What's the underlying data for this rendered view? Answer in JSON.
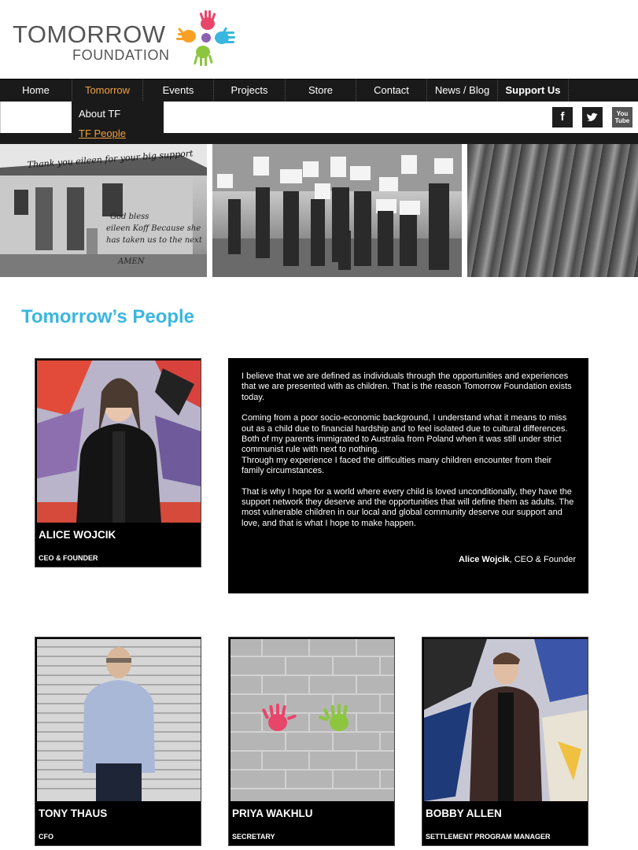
{
  "logo": {
    "line1": "TOMORROW",
    "line2": "FOUNDATION"
  },
  "nav": {
    "items": [
      {
        "label": "Home"
      },
      {
        "label": "Tomorrow"
      },
      {
        "label": "Events"
      },
      {
        "label": "Projects"
      },
      {
        "label": "Store"
      },
      {
        "label": "Contact"
      },
      {
        "label": "News / Blog"
      },
      {
        "label": "Support Us"
      }
    ],
    "dropdown": [
      {
        "label": "About TF"
      },
      {
        "label": "TF People"
      }
    ]
  },
  "social": {
    "facebook": "f",
    "youtube": "You Tube"
  },
  "banner": {
    "sign_line1": "Thank you eileen for your big support",
    "sign_line2": "God bless",
    "sign_line3": "eileen Koff Because she",
    "sign_line4": "has taken us to the next",
    "sign_line5": "AMEN"
  },
  "page": {
    "title": "Tomorrow’s People"
  },
  "people": [
    {
      "name": "ALICE WOJCIK",
      "role": "CEO & FOUNDER"
    },
    {
      "name": "TONY THAUS",
      "role": "CFO"
    },
    {
      "name": "PRIYA WAKHLU",
      "role": "SECRETARY"
    },
    {
      "name": "BOBBY ALLEN",
      "role": "SETTLEMENT PROGRAM MANAGER"
    }
  ],
  "quote": {
    "p1": "I believe that we are defined as individuals through the opportunities and experiences that we are presented with as children. That is the reason Tomorrow Foundation exists today.",
    "p2a": "Coming from a poor socio-economic background, I understand what it means to miss out as a child due to financial hardship and to feel isolated due to cultural differences. Both of my parents immigrated to Australia from Poland when it was still under strict communist rule with next to nothing.",
    "p2b": "Through my experience I faced the difficulties many children encounter from their family circumstances.",
    "p3": "That is why I hope for a world where every child is loved unconditionally, they have the support network they deserve and the opportunities that will define them as adults. The most vulnerable children in our local and global community deserve our support and love, and that is what I hope to make happen.",
    "sig_name": "Alice Wojcik",
    "sig_role": ", CEO & Founder"
  },
  "colors": {
    "accent": "#3ab6e0",
    "nav_active": "#f0a040",
    "nav_bg": "#1a1a1a"
  }
}
